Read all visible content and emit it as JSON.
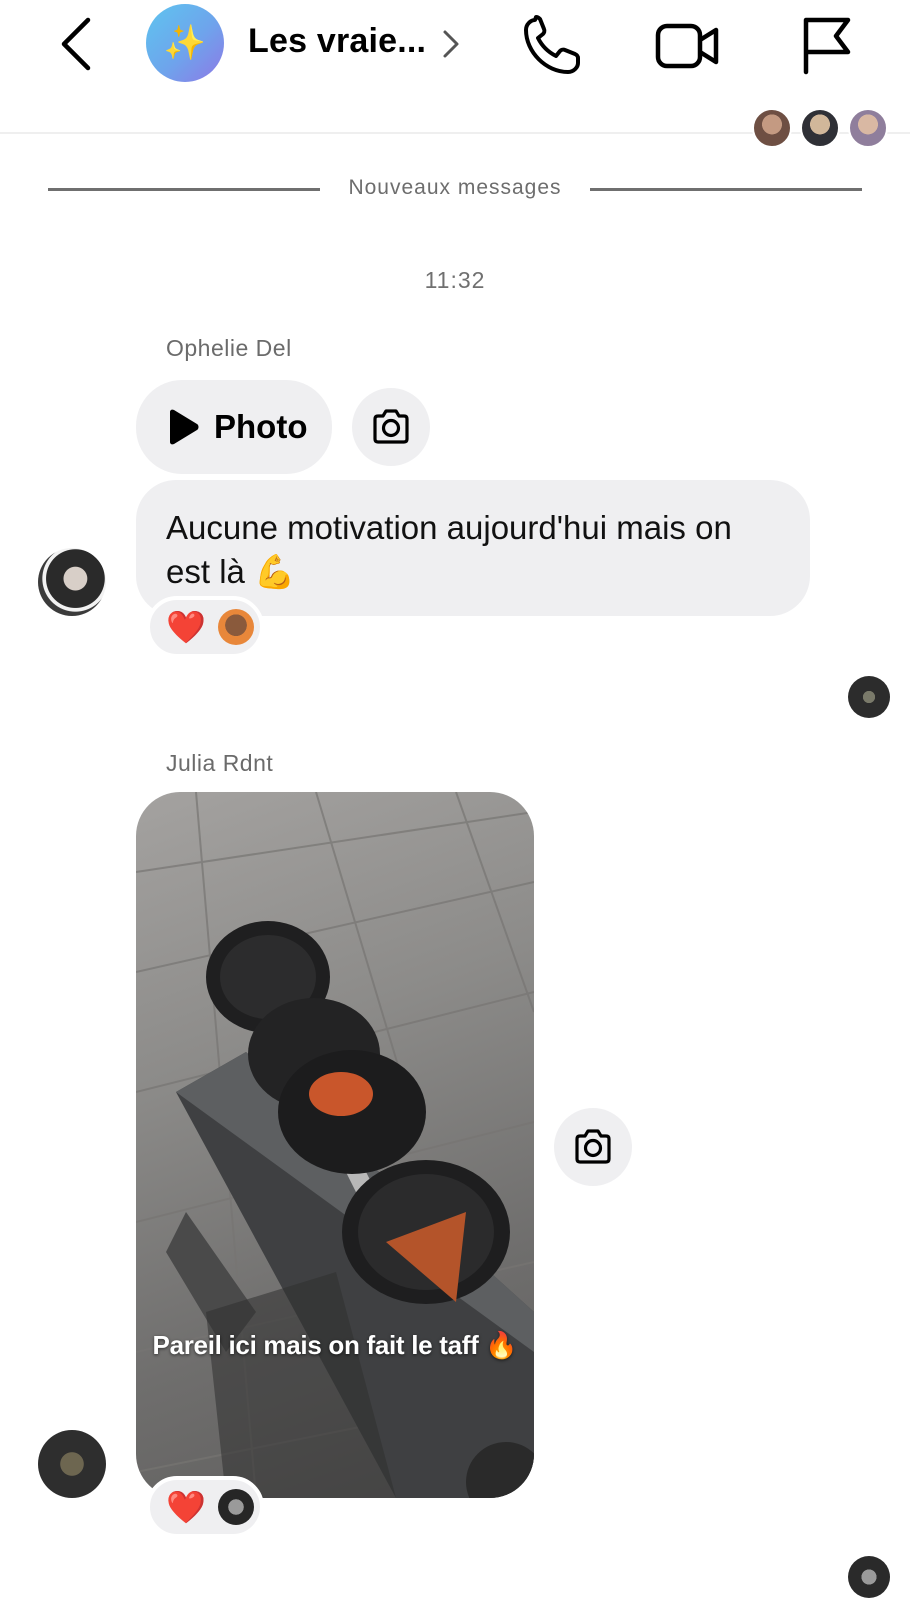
{
  "header": {
    "title": "Les vraie...",
    "group_avatar_emoji": "✨",
    "icons": {
      "back": "back-chevron-icon",
      "title_chevron": "chevron-right-icon",
      "call": "phone-icon",
      "video": "video-camera-icon",
      "report": "flag-icon"
    }
  },
  "divider": {
    "label": "Nouveaux messages"
  },
  "thread": {
    "timestamp": "11:32",
    "messages": [
      {
        "sender": "Ophelie Del",
        "photo_label": "Photo",
        "text": "Aucune motivation aujourd'hui mais on est là 💪",
        "reaction": "❤️"
      },
      {
        "sender": "Julia Rdnt",
        "media_caption": "Pareil ici mais on fait le taff 🔥",
        "reaction": "❤️"
      }
    ]
  },
  "colors": {
    "bubble": "#efeff1",
    "heart": "#e0245e",
    "group_avatar_start": "#5ec5ef",
    "group_avatar_end": "#8e78e6"
  }
}
